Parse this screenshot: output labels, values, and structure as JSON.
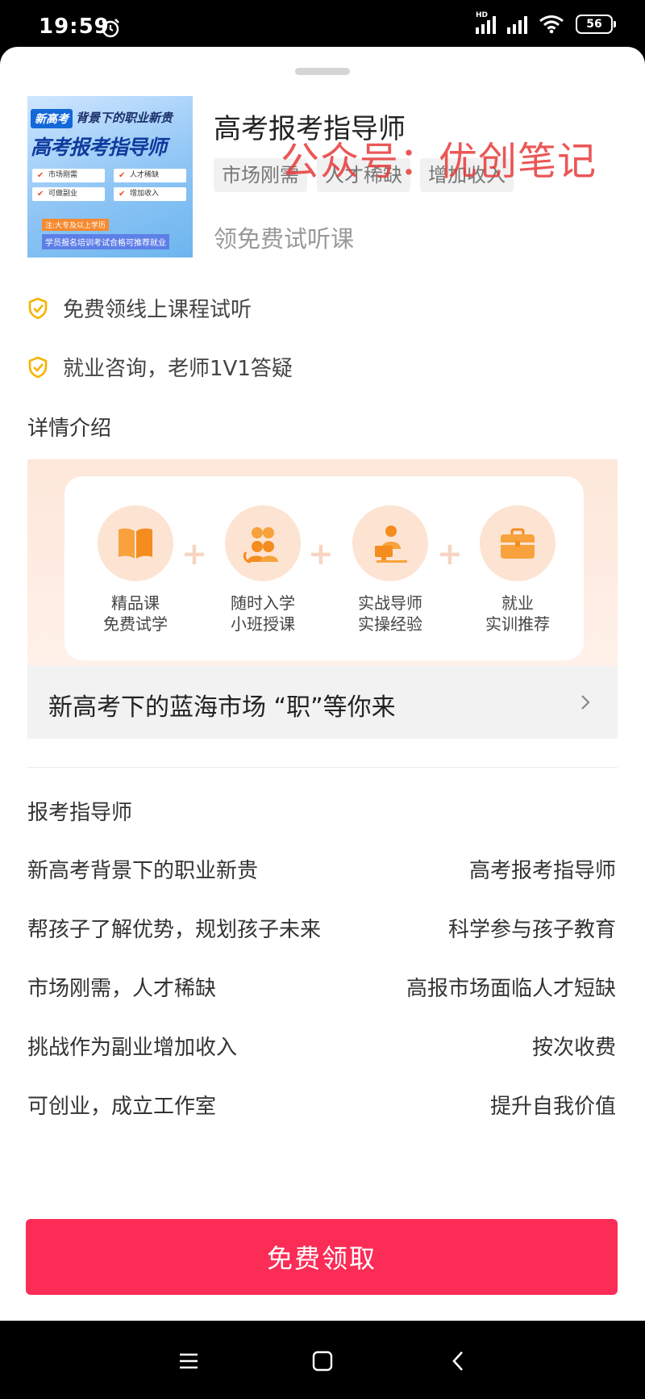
{
  "status_bar": {
    "time": "19:59",
    "network": "HD",
    "battery": "56",
    "icons": [
      "alarm-icon",
      "signal-icon",
      "wifi-icon",
      "battery-icon"
    ]
  },
  "product": {
    "cover": {
      "badge": "新高考",
      "subtitle": "背景下的职业新贵",
      "title": "高考报考指导师",
      "cells": [
        "市场刚需",
        "人才稀缺",
        "可做副业",
        "增加收入"
      ],
      "footnote": "注:大专及以上学历",
      "banner": "学员报名培训考试合格可推荐就业"
    },
    "title": "高考报考指导师",
    "tags": [
      "市场刚需",
      "人才稀缺",
      "增加收入"
    ],
    "watermark": "公众号：优创笔记",
    "trial_text": "领免费试听课"
  },
  "benefits": [
    {
      "icon": "shield-check-icon",
      "text": "免费领线上课程试听"
    },
    {
      "icon": "shield-check-icon",
      "text": "就业咨询，老师1V1答疑"
    }
  ],
  "details": {
    "title": "详情介绍",
    "features": [
      {
        "icon": "book-icon",
        "line1": "精品课",
        "line2": "免费试学"
      },
      {
        "icon": "group-icon",
        "line1": "随时入学",
        "line2": "小班授课"
      },
      {
        "icon": "teacher-icon",
        "line1": "实战导师",
        "line2": "实操经验"
      },
      {
        "icon": "briefcase-icon",
        "line1": "就业",
        "line2": "实训推荐"
      }
    ],
    "bar_text": "新高考下的蓝海市场 “职”等你来"
  },
  "spec": {
    "title": "报考指导师",
    "rows": [
      {
        "left": " 新高考背景下的职业新贵",
        "right": "高考报考指导师"
      },
      {
        "left": "帮孩子了解优势，规划孩子未来",
        "right": "科学参与孩子教育"
      },
      {
        "left": "市场刚需，人才稀缺",
        "right": "高报市场面临人才短缺"
      },
      {
        "left": "挑战作为副业增加收入",
        "right": "按次收费"
      },
      {
        "left": "可创业，成立工作室",
        "right": "提升自我价值"
      }
    ]
  },
  "cta": {
    "label": "免费领取",
    "color": "#fb2c56"
  },
  "nav_bar": {
    "icons": [
      "menu-icon",
      "home-icon",
      "back-icon"
    ]
  }
}
